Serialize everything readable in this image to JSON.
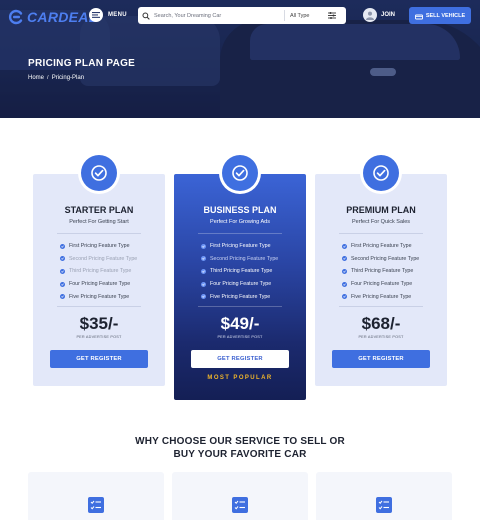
{
  "header": {
    "logo_text": "CARDEAL",
    "menu_label": "MENU",
    "search_placeholder": "Search, Your Dreaming Car",
    "type_select": "All Type",
    "join_label": "JOIN",
    "sell_label": "SELL VEHICLE"
  },
  "hero": {
    "title": "PRICING PLAN PAGE",
    "breadcrumb": [
      "Home",
      "/",
      "Pricing-Plan"
    ]
  },
  "plans": [
    {
      "name": "STARTER PLAN",
      "subtitle": "Perfect For Getting Start",
      "features": [
        {
          "label": "First Pricing Feature Type",
          "enabled": true
        },
        {
          "label": "Second Pricing Feature Type",
          "enabled": false
        },
        {
          "label": "Third Pricing Feature Type",
          "enabled": false
        },
        {
          "label": "Four Pricing Feature Type",
          "enabled": true
        },
        {
          "label": "Five Pricing Feature Type",
          "enabled": true
        }
      ],
      "price": "$35/-",
      "price_note": "PER ADVERTISE POST",
      "button_label": "GET REGISTER"
    },
    {
      "name": "BUSINESS PLAN",
      "subtitle": "Perfect For Growing Ads",
      "features": [
        {
          "label": "First Pricing Feature Type",
          "enabled": true
        },
        {
          "label": "Second Pricing Feature Type",
          "enabled": false
        },
        {
          "label": "Third Pricing Feature Type",
          "enabled": true
        },
        {
          "label": "Four Pricing Feature Type",
          "enabled": true
        },
        {
          "label": "Five Pricing Feature Type",
          "enabled": true
        }
      ],
      "price": "$49/-",
      "price_note": "PER ADVERTISE POST",
      "button_label": "GET REGISTER",
      "highlight": "MOST POPULAR"
    },
    {
      "name": "PREMIUM PLAN",
      "subtitle": "Perfect For Quick Sales",
      "features": [
        {
          "label": "First Pricing Feature Type",
          "enabled": true
        },
        {
          "label": "Second Pricing Feature Type",
          "enabled": true
        },
        {
          "label": "Third Pricing Feature Type",
          "enabled": true
        },
        {
          "label": "Four Pricing Feature Type",
          "enabled": true
        },
        {
          "label": "Five Pricing Feature Type",
          "enabled": true
        }
      ],
      "price": "$68/-",
      "price_note": "PER ADVERTISE POST",
      "button_label": "GET REGISTER"
    }
  ],
  "why_section": {
    "title_line1": "WHY CHOOSE OUR SERVICE TO SELL OR",
    "title_line2": "BUY YOUR FAVORITE CAR"
  },
  "icons": {
    "plan_badge": "check-circle-icon",
    "feature_bullet": "check-dot-icon",
    "why_card": "checklist-icon"
  },
  "colors": {
    "accent": "#3f6fe0",
    "hero_bg": "#1c2a55",
    "card_bg": "#e3e8f9",
    "featured_card_top": "#3b64d6",
    "featured_card_bottom": "#141f55",
    "popular_text": "#f0b52a"
  }
}
